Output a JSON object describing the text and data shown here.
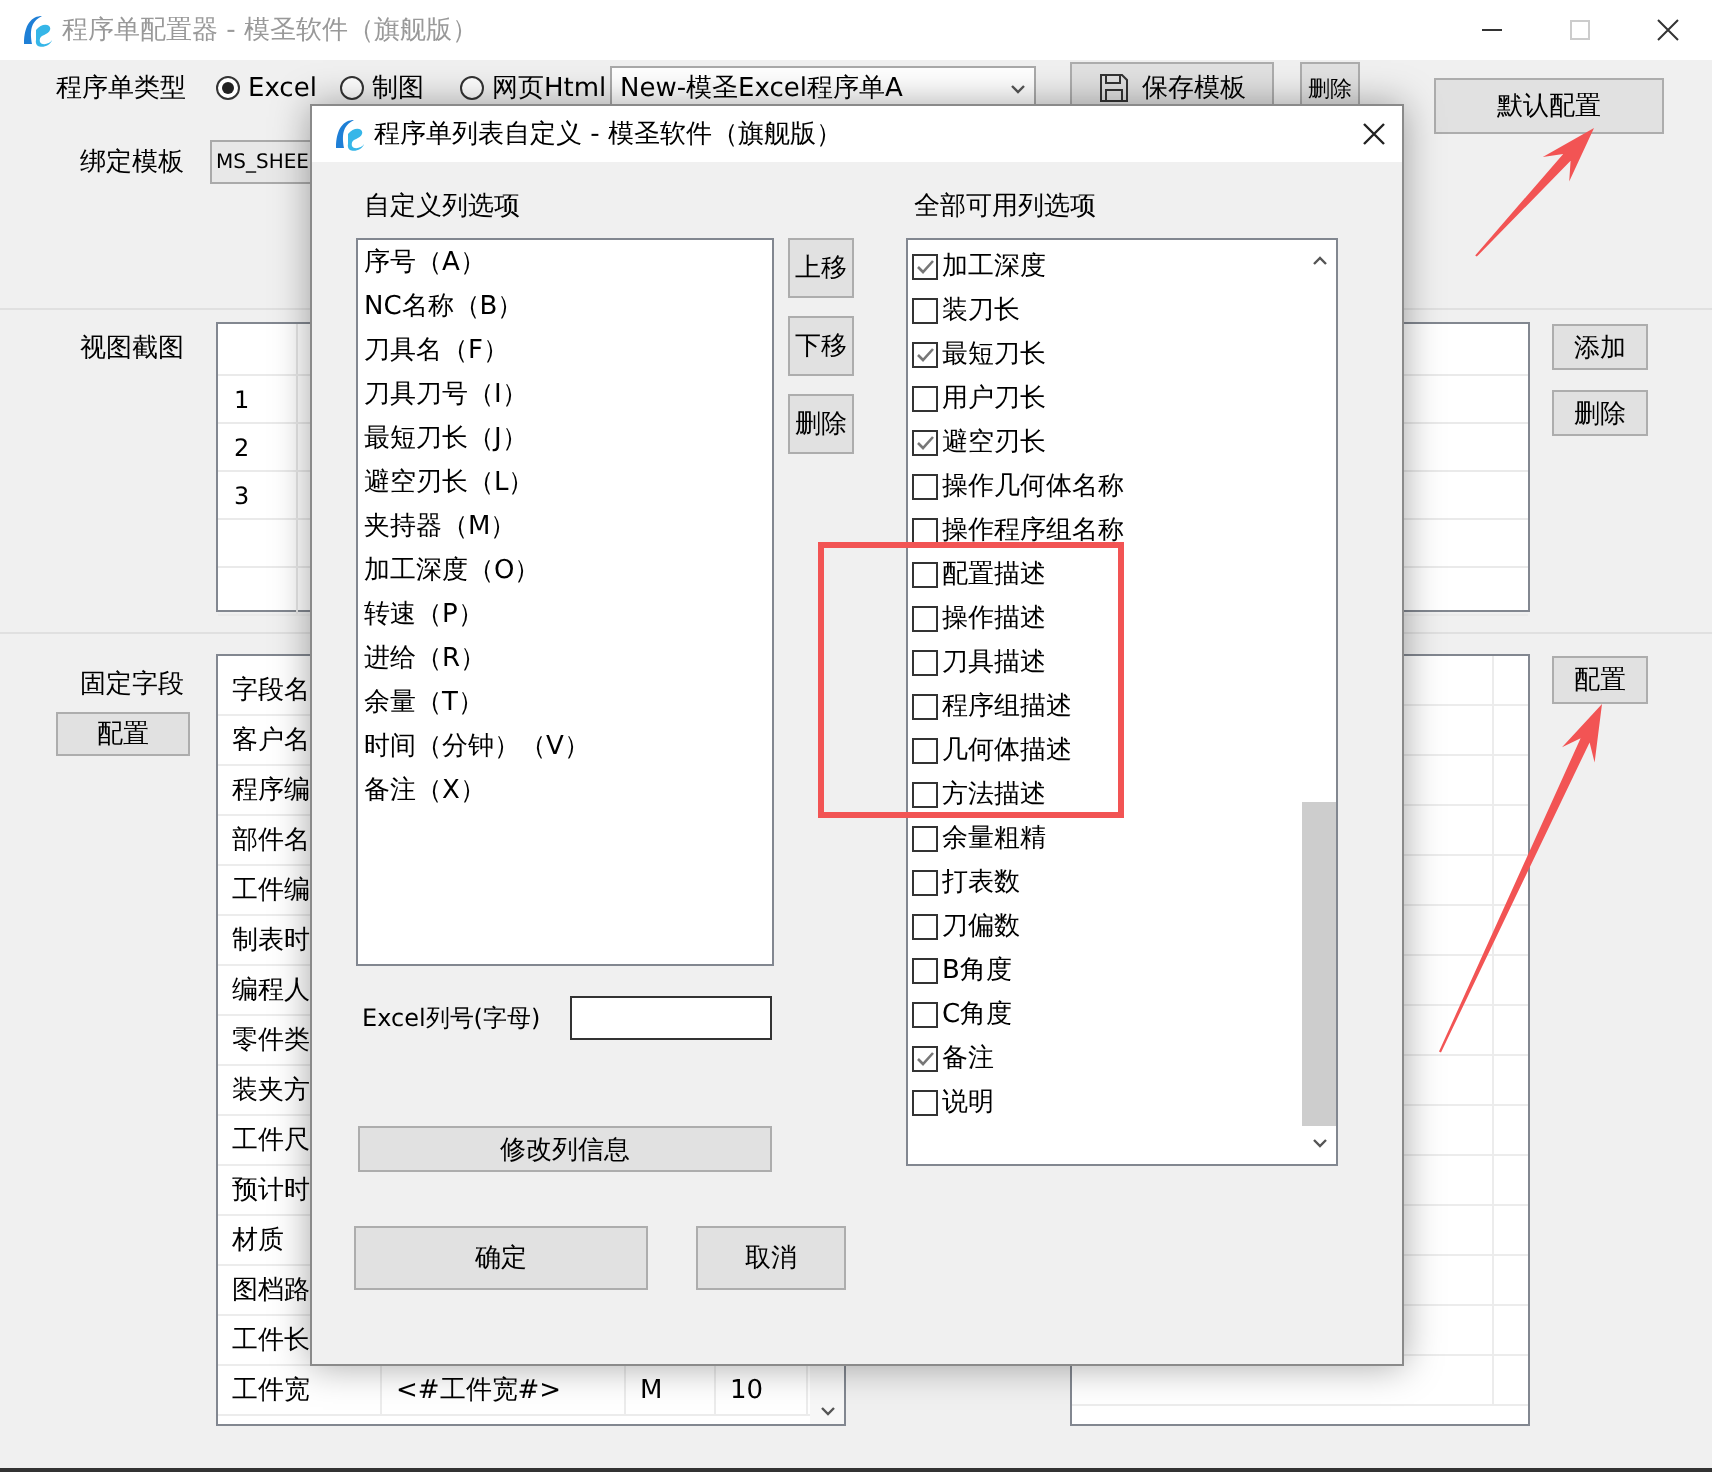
{
  "window": {
    "title": "程序单配置器 - 模圣软件（旗舰版）"
  },
  "type_row": {
    "label": "程序单类型",
    "options": [
      {
        "label": "Excel",
        "selected": true
      },
      {
        "label": "制图",
        "selected": false
      },
      {
        "label": "网页Html",
        "selected": false
      }
    ],
    "template_select": "New-模圣Excel程序单A",
    "save_button": "保存模板",
    "delete_button": "删除",
    "default_button": "默认配置"
  },
  "bind_row": {
    "label": "绑定模板",
    "value": "MS_SHEE"
  },
  "view_section": {
    "label": "视图截图",
    "rows": [
      "1",
      "2",
      "3"
    ],
    "buttons": [
      "添加",
      "删除"
    ]
  },
  "fixed_section": {
    "label": "固定字段",
    "config_button": "配置",
    "rows": [
      [
        "字段名"
      ],
      [
        "客户名"
      ],
      [
        "程序编"
      ],
      [
        "部件名"
      ],
      [
        "工件编"
      ],
      [
        "制表时"
      ],
      [
        "编程人"
      ],
      [
        "零件类"
      ],
      [
        "装夹方"
      ],
      [
        "工件尺"
      ],
      [
        "预计时"
      ],
      [
        "材质"
      ],
      [
        "图档路"
      ],
      [
        "工件长"
      ],
      [
        "工件宽",
        "<#工件宽#>",
        "M",
        "10"
      ]
    ],
    "right_config_button": "配置"
  },
  "dialog": {
    "title": "程序单列表自定义 - 模圣软件（旗舰版）",
    "custom_label": "自定义列选项",
    "custom_items": [
      "序号（A）",
      "NC名称（B）",
      "刀具名（F）",
      "刀具刀号（I）",
      "最短刀长（J）",
      "避空刃长（L）",
      "夹持器（M）",
      "加工深度（O）",
      "转速（P）",
      "进给（R）",
      "余量（T）",
      "时间（分钟）（V）",
      "备注（X）"
    ],
    "move_buttons": [
      "上移",
      "下移",
      "删除"
    ],
    "available_label": "全部可用列选项",
    "available_items": [
      {
        "label": "加工深度",
        "checked": true
      },
      {
        "label": "装刀长",
        "checked": false
      },
      {
        "label": "最短刀长",
        "checked": true
      },
      {
        "label": "用户刀长",
        "checked": false
      },
      {
        "label": "避空刃长",
        "checked": true
      },
      {
        "label": "操作几何体名称",
        "checked": false
      },
      {
        "label": "操作程序组名称",
        "checked": false
      },
      {
        "label": "配置描述",
        "checked": false
      },
      {
        "label": "操作描述",
        "checked": false
      },
      {
        "label": "刀具描述",
        "checked": false
      },
      {
        "label": "程序组描述",
        "checked": false
      },
      {
        "label": "几何体描述",
        "checked": false
      },
      {
        "label": "方法描述",
        "checked": false
      },
      {
        "label": "余量粗精",
        "checked": false
      },
      {
        "label": "打表数",
        "checked": false
      },
      {
        "label": "刀偏数",
        "checked": false
      },
      {
        "label": "B角度",
        "checked": false
      },
      {
        "label": "C角度",
        "checked": false
      },
      {
        "label": "备注",
        "checked": true
      },
      {
        "label": "说明",
        "checked": false
      }
    ],
    "excel_column_label": "Excel列号(字母)",
    "modify_button": "修改列信息",
    "ok_button": "确定",
    "cancel_button": "取消"
  }
}
